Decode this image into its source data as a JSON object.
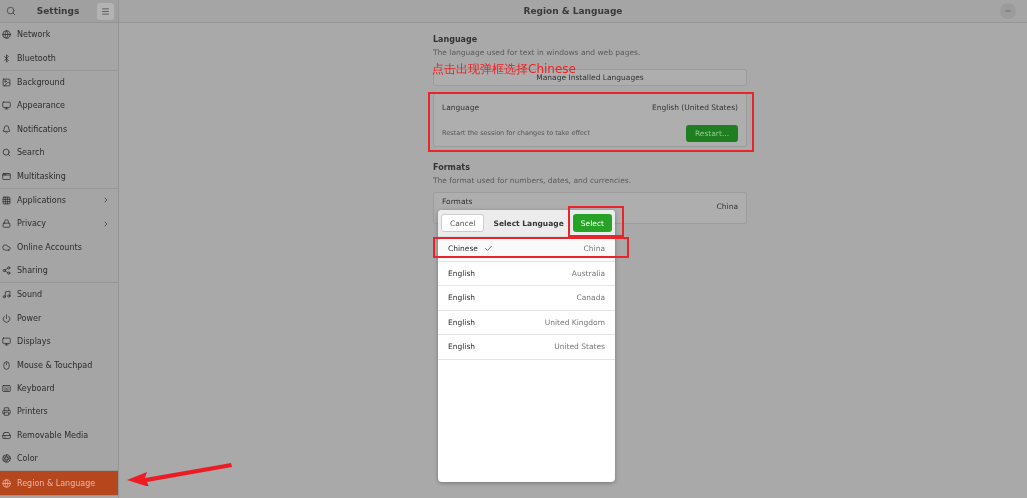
{
  "sidebar": {
    "title": "Settings",
    "groups": [
      [
        {
          "label": "Network",
          "submenu": false,
          "selected": false
        },
        {
          "label": "Bluetooth",
          "submenu": false,
          "selected": false
        }
      ],
      [
        {
          "label": "Background",
          "submenu": false,
          "selected": false
        },
        {
          "label": "Appearance",
          "submenu": false,
          "selected": false
        },
        {
          "label": "Notifications",
          "submenu": false,
          "selected": false
        },
        {
          "label": "Search",
          "submenu": false,
          "selected": false
        },
        {
          "label": "Multitasking",
          "submenu": false,
          "selected": false
        }
      ],
      [
        {
          "label": "Applications",
          "submenu": true,
          "selected": false
        },
        {
          "label": "Privacy",
          "submenu": true,
          "selected": false
        },
        {
          "label": "Online Accounts",
          "submenu": false,
          "selected": false
        },
        {
          "label": "Sharing",
          "submenu": false,
          "selected": false
        }
      ],
      [
        {
          "label": "Sound",
          "submenu": false,
          "selected": false
        },
        {
          "label": "Power",
          "submenu": false,
          "selected": false
        },
        {
          "label": "Displays",
          "submenu": false,
          "selected": false
        },
        {
          "label": "Mouse & Touchpad",
          "submenu": false,
          "selected": false
        },
        {
          "label": "Keyboard",
          "submenu": false,
          "selected": false
        },
        {
          "label": "Printers",
          "submenu": false,
          "selected": false
        },
        {
          "label": "Removable Media",
          "submenu": false,
          "selected": false
        },
        {
          "label": "Color",
          "submenu": false,
          "selected": false
        }
      ],
      [
        {
          "label": "Region & Language",
          "submenu": false,
          "selected": true
        }
      ]
    ]
  },
  "window": {
    "title": "Region & Language"
  },
  "language": {
    "heading": "Language",
    "description": "The language used for text in windows and web pages.",
    "manage_button": "Manage Installed Languages",
    "row_label": "Language",
    "row_value": "English (United States)",
    "restart_note": "Restart the session for changes to take effect",
    "restart_button": "Restart..."
  },
  "formats": {
    "heading": "Formats",
    "description": "The format used for numbers, dates, and currencies.",
    "row_label": "Formats",
    "row_value": "China"
  },
  "dialog": {
    "cancel": "Cancel",
    "title": "Select Language",
    "select": "Select",
    "languages": [
      {
        "language": "Chinese",
        "region": "China",
        "selected": true
      },
      {
        "language": "English",
        "region": "Australia",
        "selected": false
      },
      {
        "language": "English",
        "region": "Canada",
        "selected": false
      },
      {
        "language": "English",
        "region": "United Kingdom",
        "selected": false
      },
      {
        "language": "English",
        "region": "United States",
        "selected": false
      }
    ]
  },
  "annotation": {
    "note": "点击出现弹框选择Chinese"
  }
}
